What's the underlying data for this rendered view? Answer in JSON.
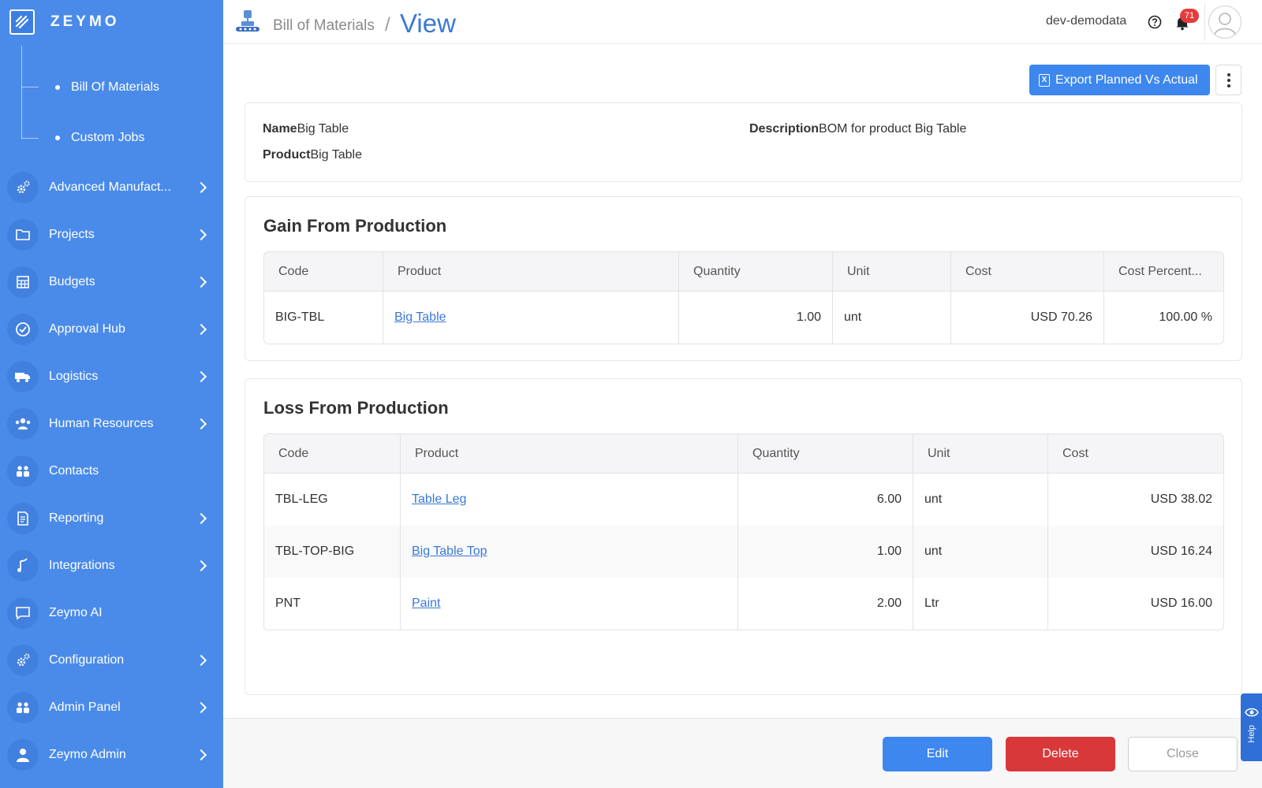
{
  "brand": {
    "name": "ZEYMO"
  },
  "sidebar": {
    "subitems": [
      {
        "label": "Bill Of Materials"
      },
      {
        "label": "Custom Jobs"
      }
    ],
    "items": [
      {
        "label": "Advanced Manufact...",
        "icon": "gears-icon",
        "has_children": true
      },
      {
        "label": "Projects",
        "icon": "folder-icon",
        "has_children": true
      },
      {
        "label": "Budgets",
        "icon": "calculator-icon",
        "has_children": true
      },
      {
        "label": "Approval Hub",
        "icon": "check-circle-icon",
        "has_children": true
      },
      {
        "label": "Logistics",
        "icon": "truck-icon",
        "has_children": true
      },
      {
        "label": "Human Resources",
        "icon": "people-icon",
        "has_children": true
      },
      {
        "label": "Contacts",
        "icon": "contacts-icon",
        "has_children": false
      },
      {
        "label": "Reporting",
        "icon": "report-icon",
        "has_children": true
      },
      {
        "label": "Integrations",
        "icon": "integration-icon",
        "has_children": true
      },
      {
        "label": "Zeymo AI",
        "icon": "chat-icon",
        "has_children": false
      },
      {
        "label": "Configuration",
        "icon": "gears-icon",
        "has_children": true
      },
      {
        "label": "Admin Panel",
        "icon": "admin-icon",
        "has_children": true
      },
      {
        "label": "Zeymo Admin",
        "icon": "user-icon",
        "has_children": true
      }
    ]
  },
  "header": {
    "breadcrumb_parent": "Bill of Materials",
    "separator": "/",
    "breadcrumb_current": "View",
    "company": "dev-demodata",
    "notification_count": "71"
  },
  "actions": {
    "export_label": "Export Planned Vs Actual"
  },
  "details": {
    "name_label": "Name",
    "name_value": "Big Table",
    "product_label": "Product",
    "product_value": "Big Table",
    "description_label": "Description",
    "description_value": "BOM for product Big Table"
  },
  "gain": {
    "title": "Gain From Production",
    "columns": [
      "Code",
      "Product",
      "Quantity",
      "Unit",
      "Cost",
      "Cost Percent..."
    ],
    "rows": [
      {
        "code": "BIG-TBL",
        "product": "Big Table",
        "quantity": "1.00",
        "unit": "unt",
        "cost": "USD 70.26",
        "percent": "100.00 %"
      }
    ]
  },
  "loss": {
    "title": "Loss From Production",
    "columns": [
      "Code",
      "Product",
      "Quantity",
      "Unit",
      "Cost"
    ],
    "rows": [
      {
        "code": "TBL-LEG",
        "product": "Table Leg",
        "quantity": "6.00",
        "unit": "unt",
        "cost": "USD 38.02"
      },
      {
        "code": "TBL-TOP-BIG",
        "product": "Big Table Top",
        "quantity": "1.00",
        "unit": "unt",
        "cost": "USD 16.24"
      },
      {
        "code": "PNT",
        "product": "Paint",
        "quantity": "2.00",
        "unit": "Ltr",
        "cost": "USD 16.00"
      }
    ]
  },
  "footer": {
    "edit_label": "Edit",
    "delete_label": "Delete",
    "close_label": "Close"
  },
  "help_tab": {
    "label": "Help"
  },
  "colors": {
    "sidebar": "#4a8bea",
    "primary": "#3d87ef",
    "danger": "#d9383a",
    "link": "#3a79d6"
  }
}
